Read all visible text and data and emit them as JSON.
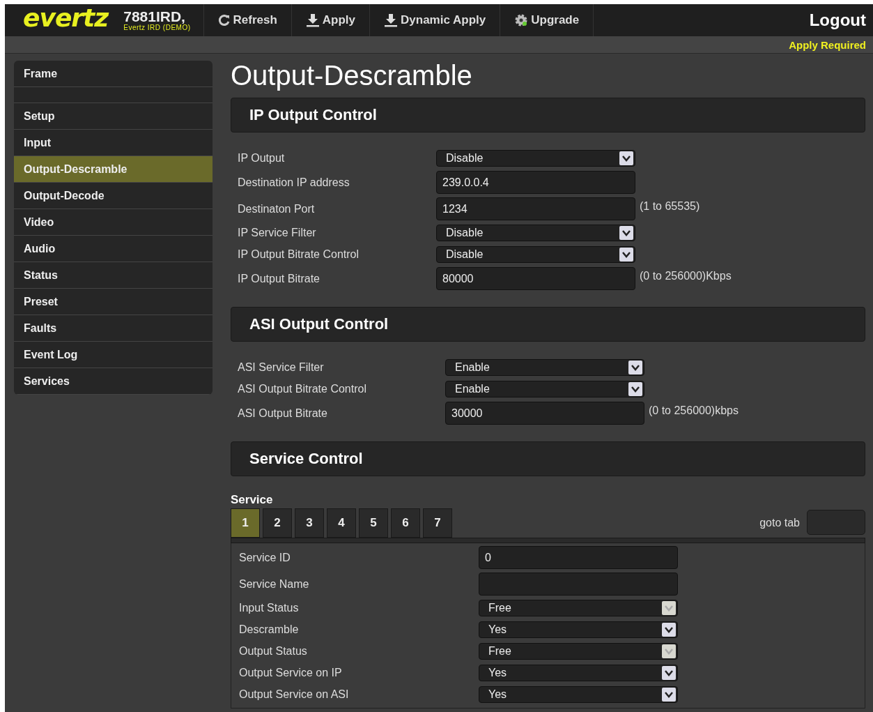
{
  "header": {
    "logo": "evertz",
    "device": "7881IRD,",
    "device_sub": "Evertz IRD (DEMO)",
    "buttons": [
      {
        "label": "Refresh",
        "kind": "refresh"
      },
      {
        "label": "Apply",
        "kind": "download"
      },
      {
        "label": "Dynamic Apply",
        "kind": "download"
      },
      {
        "label": "Upgrade",
        "kind": "gear"
      }
    ],
    "logout": "Logout"
  },
  "notice": "Apply Required",
  "sidebar": {
    "groups": [
      [
        {
          "label": "Frame",
          "selected": false
        }
      ],
      [
        {
          "label": "Setup",
          "selected": false
        },
        {
          "label": "Input",
          "selected": false
        },
        {
          "label": "Output-Descramble",
          "selected": true
        },
        {
          "label": "Output-Decode",
          "selected": false
        },
        {
          "label": "Video",
          "selected": false
        },
        {
          "label": "Audio",
          "selected": false
        },
        {
          "label": "Status",
          "selected": false
        },
        {
          "label": "Preset",
          "selected": false
        },
        {
          "label": "Faults",
          "selected": false
        },
        {
          "label": "Event Log",
          "selected": false
        },
        {
          "label": "Services",
          "selected": false
        }
      ]
    ]
  },
  "title": "Output-Descramble",
  "sections": [
    {
      "title": "IP Output Control",
      "fields": [
        {
          "label": "IP Output",
          "kind": "select",
          "value": "Disable",
          "disabled": false
        },
        {
          "label": "Destination IP address",
          "kind": "text",
          "value": "239.0.0.4"
        },
        {
          "label": "Destinaton Port",
          "kind": "text",
          "value": "1234",
          "hint": "(1 to 65535)"
        },
        {
          "label": "IP Service Filter",
          "kind": "select",
          "value": "Disable",
          "disabled": false
        },
        {
          "label": "IP Output Bitrate Control",
          "kind": "select",
          "value": "Disable",
          "disabled": false
        },
        {
          "label": "IP Output Bitrate",
          "kind": "text",
          "value": "80000",
          "hint": "(0 to 256000)Kbps"
        }
      ]
    },
    {
      "title": "ASI Output Control",
      "fields": [
        {
          "label": "ASI Service Filter",
          "kind": "select",
          "value": "Enable",
          "disabled": false
        },
        {
          "label": "ASI Output Bitrate Control",
          "kind": "select",
          "value": "Enable",
          "disabled": false
        },
        {
          "label": "ASI Output Bitrate",
          "kind": "text",
          "value": "30000",
          "hint": "(0 to 256000)kbps"
        }
      ]
    },
    {
      "title": "Service Control"
    }
  ],
  "service": {
    "label": "Service",
    "tabs": [
      {
        "label": "1",
        "selected": true
      },
      {
        "label": "2",
        "selected": false
      },
      {
        "label": "3",
        "selected": false
      },
      {
        "label": "4",
        "selected": false
      },
      {
        "label": "5",
        "selected": false
      },
      {
        "label": "6",
        "selected": false
      },
      {
        "label": "7",
        "selected": false
      }
    ],
    "goto_label": "goto tab",
    "fields": [
      {
        "label": "Service ID",
        "kind": "text",
        "value": "0"
      },
      {
        "label": "Service Name",
        "kind": "text"
      },
      {
        "label": "Input Status",
        "kind": "select",
        "value": "Free",
        "disabled": true
      },
      {
        "label": "Descramble",
        "kind": "select",
        "value": "Yes",
        "disabled": false
      },
      {
        "label": "Output Status",
        "kind": "select",
        "value": "Free",
        "disabled": true
      },
      {
        "label": "Output Service on IP",
        "kind": "select",
        "value": "Yes",
        "disabled": false
      },
      {
        "label": "Output Service on ASI",
        "kind": "select",
        "value": "Yes",
        "disabled": false
      }
    ]
  }
}
